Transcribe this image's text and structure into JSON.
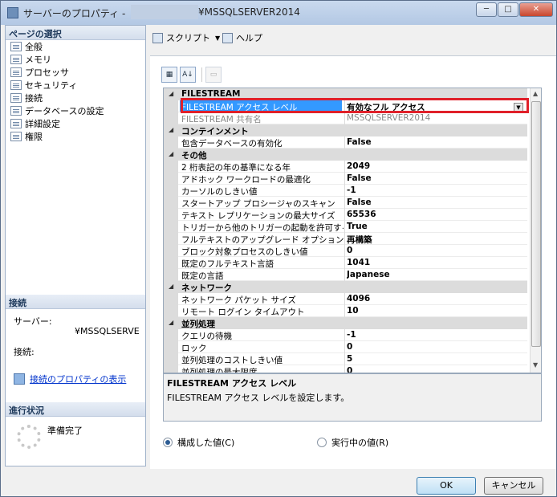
{
  "window": {
    "title_prefix": "サーバーのプロパティ -",
    "title_suffix": "¥MSSQLSERVER2014",
    "btn_minimize": "─",
    "btn_maximize": "□",
    "btn_close": "✕"
  },
  "left": {
    "pages_header": "ページの選択",
    "pages": [
      "全般",
      "メモリ",
      "プロセッサ",
      "セキュリティ",
      "接続",
      "データベースの設定",
      "詳細設定",
      "権限"
    ],
    "connection_header": "接続",
    "server_label": "サーバー:",
    "server_value": "¥MSSQLSERVE",
    "connection_label": "接続:",
    "connection_props_link": "接続のプロパティの表示",
    "progress_header": "進行状況",
    "progress_status": "準備完了"
  },
  "toolbar": {
    "script_label": "スクリプト",
    "help_label": "ヘルプ",
    "dropdown_arrow": "▼"
  },
  "grid_toolbar": {
    "categorized": "▦",
    "alphabetical": "A↓",
    "property_pages": "▭"
  },
  "grid": {
    "rows": [
      {
        "kind": "cat",
        "label": "FILESTREAM"
      },
      {
        "kind": "prop",
        "name": "FILESTREAM アクセス レベル",
        "value": "有効なフル アクセス",
        "selected": true
      },
      {
        "kind": "prop",
        "name": "FILESTREAM 共有名",
        "value": "MSSQLSERVER2014",
        "disabled": true
      },
      {
        "kind": "cat",
        "label": "コンテインメント"
      },
      {
        "kind": "prop",
        "name": "包含データベースの有効化",
        "value": "False"
      },
      {
        "kind": "cat",
        "label": "その他"
      },
      {
        "kind": "prop",
        "name": "2 桁表記の年の基準になる年",
        "value": "2049"
      },
      {
        "kind": "prop",
        "name": "アドホック ワークロードの最適化",
        "value": "False"
      },
      {
        "kind": "prop",
        "name": "カーソルのしきい値",
        "value": "-1"
      },
      {
        "kind": "prop",
        "name": "スタートアップ プロシージャのスキャン",
        "value": "False"
      },
      {
        "kind": "prop",
        "name": "テキスト レプリケーションの最大サイズ",
        "value": "65536"
      },
      {
        "kind": "prop",
        "name": "トリガーから他のトリガーの起動を許可する",
        "value": "True"
      },
      {
        "kind": "prop",
        "name": "フルテキストのアップグレード オプション",
        "value": "再構築"
      },
      {
        "kind": "prop",
        "name": "ブロック対象プロセスのしきい値",
        "value": "0"
      },
      {
        "kind": "prop",
        "name": "既定のフルテキスト言語",
        "value": "1041"
      },
      {
        "kind": "prop",
        "name": "既定の言語",
        "value": "Japanese"
      },
      {
        "kind": "cat",
        "label": "ネットワーク"
      },
      {
        "kind": "prop",
        "name": "ネットワーク パケット サイズ",
        "value": "4096"
      },
      {
        "kind": "prop",
        "name": "リモート ログイン タイムアウト",
        "value": "10"
      },
      {
        "kind": "cat",
        "label": "並列処理"
      },
      {
        "kind": "prop",
        "name": "クエリの待機",
        "value": "-1"
      },
      {
        "kind": "prop",
        "name": "ロック",
        "value": "0"
      },
      {
        "kind": "prop",
        "name": "並列処理のコストしきい値",
        "value": "5"
      },
      {
        "kind": "prop",
        "name": "並列処理の最大限度",
        "value": "0"
      }
    ],
    "collapse_glyph": "◢",
    "dropdown_glyph": "▼",
    "scroll_up": "▲",
    "scroll_down": "▼"
  },
  "description": {
    "title": "FILESTREAM アクセス レベル",
    "text": "FILESTREAM アクセス レベルを設定します。"
  },
  "radio": {
    "configured": "構成した値(C)",
    "running": "実行中の値(R)",
    "selected": "configured"
  },
  "footer": {
    "ok": "OK",
    "cancel": "キャンセル"
  },
  "colors": {
    "selection": "#3399ff",
    "highlight_border": "#e0202a",
    "link": "#0033cc"
  }
}
